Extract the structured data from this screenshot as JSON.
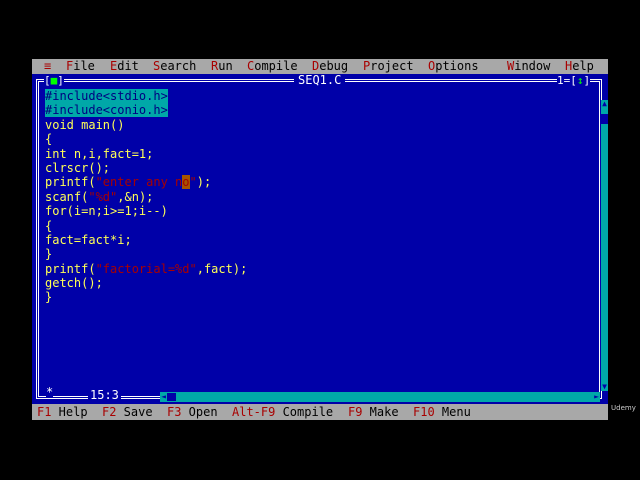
{
  "menu": {
    "system": "≡",
    "items": [
      {
        "hotkey": "F",
        "rest": "ile"
      },
      {
        "hotkey": "E",
        "rest": "dit"
      },
      {
        "hotkey": "S",
        "rest": "earch"
      },
      {
        "hotkey": "R",
        "rest": "un"
      },
      {
        "hotkey": "C",
        "rest": "ompile"
      },
      {
        "hotkey": "D",
        "rest": "ebug"
      },
      {
        "hotkey": "P",
        "rest": "roject"
      },
      {
        "hotkey": "O",
        "rest": "ptions"
      },
      {
        "hotkey": "W",
        "rest": "indow"
      },
      {
        "hotkey": "H",
        "rest": "elp"
      }
    ]
  },
  "window": {
    "title": "SEQ1.C",
    "close_box": "■",
    "number": "1",
    "zoom_box": "↕"
  },
  "code": {
    "l1": "#include<stdio.h>",
    "l2": "#include<conio.h>",
    "l3": "void main()",
    "l4": "{",
    "l5": "int n,i,fact=1;",
    "l6": "clrscr();",
    "l7_a": "printf(",
    "l7_s1": "\"enter any n",
    "l7_cur": "o",
    "l7_s2": "\"",
    "l7_b": ");",
    "l8_a": "scanf(",
    "l8_s": "\"%d\"",
    "l8_b": ",&n);",
    "l9": "for(i=n;i>=1;i--)",
    "l10": "{",
    "l11": "fact=fact*i;",
    "l12": "}",
    "l13_a": "printf(",
    "l13_s": "\"factorial=%d\"",
    "l13_b": ",fact);",
    "l14": "getch();",
    "l15": "}"
  },
  "cursor_position": "15:3",
  "modified_marker": "*",
  "status": [
    {
      "key": "F1",
      "label": " Help"
    },
    {
      "key": "F2",
      "label": " Save"
    },
    {
      "key": "F3",
      "label": " Open"
    },
    {
      "key": "Alt-F9",
      "label": " Compile"
    },
    {
      "key": "F9",
      "label": " Make"
    },
    {
      "key": "F10",
      "label": " Menu"
    }
  ],
  "watermark": "Udemy"
}
